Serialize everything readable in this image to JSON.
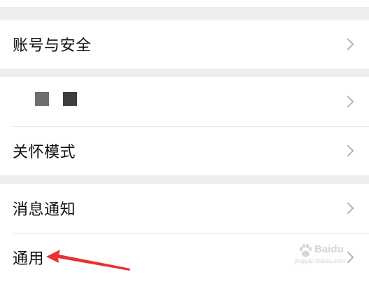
{
  "settings": {
    "items": [
      {
        "label": "账号与安全"
      },
      {
        "label": ""
      },
      {
        "label": "关怀模式"
      },
      {
        "label": "消息通知"
      },
      {
        "label": "通用"
      }
    ]
  },
  "watermark": {
    "brand": "Baidu",
    "url": "jingyan.baidu.com"
  },
  "colors": {
    "background": "#ededed",
    "row": "#ffffff",
    "text": "#111111",
    "chevron": "#b3b3b3",
    "annotation_arrow": "#e8312f"
  }
}
